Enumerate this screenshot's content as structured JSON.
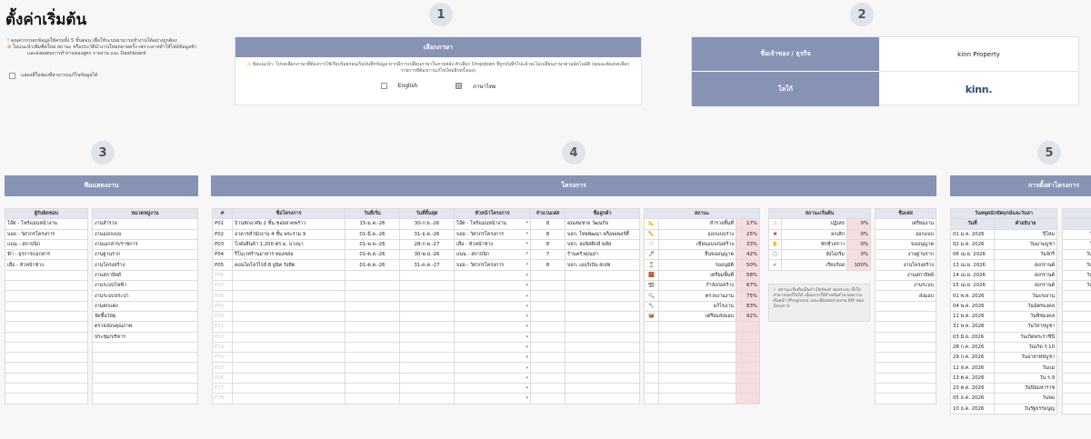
{
  "page_title": "ตั้งค่าเริ่มต้น",
  "notes": {
    "line1": "คุณควรกรอกข้อมูลให้ครบทั้ง 5 ขั้นตอน เพื่อให้ระบบสามารถทำงานได้อย่างถูกต้อง",
    "line2a": "ไม่แนะนำเพิ่มซีตใหม่ สถานะ หรือประวัตินำงานใหม่หลายครั้ง เพราะอาจทำให้ไฟล์ข้อมูลช้า",
    "line2b": "และส่งผลต่อการทำงานของสูตร รายงาน และ Dashboard",
    "checkbox_label": "แสดงสีในช่องที่สามารถแก้ไขข้อมูลได้"
  },
  "steps": [
    "1",
    "2",
    "3",
    "4",
    "5"
  ],
  "language": {
    "header": "เลือกภาษา",
    "hint": "ข้อแนะนำ: โปรดเลือกภาษาที่ต้องการใช้เรียบร้อยก่อนเริ่มบันทึกข้อมูล หากมีการเปลี่ยนภาษาในภายหลัง ตัวเลือก Dropdown ที่ถูกบันทึกไปแล้วจะไม่เปลี่ยนภาษาตามอัตโนมัติ (คุณจะต้องกดเลือกรายการที่ต้องการแก้ไขใหม่อีกครั้งเอง)",
    "english": "English",
    "thai": "ภาษาไทย"
  },
  "owner": {
    "owner_label": "ชื่อเจ้าของ / ธุรกิจ",
    "owner_value": "kinn Property",
    "logo_label": "โลโก้",
    "logo_text": "kinn."
  },
  "team": {
    "header": "ทีมแสดงงาน",
    "owners_header": "ผู้รับผิดชอบ",
    "owners": [
      "โอ๊ต - โฟร์แมนหน้างาน",
      "บอย - วิศวกรโครงการ",
      "แนน - สถาปนิก",
      "ฟ้า - ธุรการ/เอกสาร",
      "เสือ - หัวหน้าช่าง"
    ],
    "category_header": "หมวดหมู่งาน",
    "categories": [
      "งานสำรวจ",
      "งานออกแบบ",
      "งานเอกสาร/ราชการ",
      "งานฐานราก",
      "งานโครงสร้าง",
      "งานสถาปัตย์",
      "งานระบบไฟฟ้า",
      "งานระบบประปา",
      "งานตกแต่ง",
      "จัดซื้อวัสดุ",
      "ตรวจสอบคุณภาพ",
      "ประชุม/บริหาร"
    ]
  },
  "projects": {
    "header": "โครงการ",
    "columns": [
      "#",
      "ชื่อโครงการ",
      "วันที่เริ่ม",
      "วันที่สิ้นสุด",
      "หัวหน้าโครงการ",
      "จำนวนเฟส",
      "ชื่อลูกค้า"
    ],
    "rows": [
      {
        "id": "P01",
        "name": "บ้านพักอาศัย 2 ชั้น ซอยลาดพร้าว",
        "start": "15-ม.ค.-26",
        "end": "30-ก.ย.-26",
        "lead": "โอ๊ต - โฟร์แมนหน้างาน",
        "phases": "8",
        "client": "คุณสมชาย วัฒนกิจ"
      },
      {
        "id": "P02",
        "name": "อาคารสำนักงาน 4 ชั้น พระราม 9",
        "start": "01-มี.ค.-26",
        "end": "31-ธ.ค.-26",
        "lead": "บอย - วิศวกรโครงการ",
        "phases": "8",
        "client": "บจก. ไทยพัฒนา พร็อพเพอร์ตี้"
      },
      {
        "id": "P03",
        "name": "โกดังสินค้า 1,200 ตร.ม. บางนา",
        "start": "01-พ.ค.-26",
        "end": "28-ก.พ.-27",
        "lead": "เสือ - หัวหน้าช่าง",
        "phases": "8",
        "client": "บจก. ลอจิสติกส์ พลัส"
      },
      {
        "id": "P04",
        "name": "รีโนเวทร้านอาหาร ทองหล่อ",
        "start": "01-ต.ค.-26",
        "end": "30-พ.ย.-26",
        "lead": "แนน - สถาปนิก",
        "phases": "7",
        "client": "ร้านครัวคุณย่า"
      },
      {
        "id": "P05",
        "name": "คอนโดโลว์ไรส์ 8 ยูนิต รังสิต",
        "start": "01-ต.ค.-26",
        "end": "31-ค.ค.-27",
        "lead": "บอย - วิศวกรโครงการ",
        "phases": "8",
        "client": "บจก. เออร์เบิน สเปซ"
      }
    ],
    "empty_ids": [
      "P06",
      "P07",
      "P08",
      "P09",
      "P10",
      "P11",
      "P12",
      "P13",
      "P14",
      "P15",
      "P16",
      "P17",
      "P18"
    ]
  },
  "status": {
    "header": "สถานะ",
    "rows": [
      {
        "icon": "ruler-icon",
        "glyph": "📐",
        "label": "สำรวจพื้นที่",
        "pct": "17%"
      },
      {
        "icon": "pencil-icon",
        "glyph": "✏️",
        "label": "ออกแบบร่าง",
        "pct": "25%"
      },
      {
        "icon": "document-icon",
        "glyph": "📄",
        "label": "เขียนแบบก่อสร้าง",
        "pct": "33%"
      },
      {
        "icon": "pen-icon",
        "glyph": "🖊",
        "label": "ยื่นขออนุญาต",
        "pct": "42%"
      },
      {
        "icon": "hourglass-icon",
        "glyph": "⌛",
        "label": "รออนุมัติ",
        "pct": "50%"
      },
      {
        "icon": "bricks-icon",
        "glyph": "🧱",
        "label": "เตรียมพื้นที่",
        "pct": "58%"
      },
      {
        "icon": "crane-icon",
        "glyph": "🏗",
        "label": "กำลังก่อสร้าง",
        "pct": "67%"
      },
      {
        "icon": "magnifier-icon",
        "glyph": "🔍",
        "label": "ตรวจงานงาน",
        "pct": "75%"
      },
      {
        "icon": "wrench-icon",
        "glyph": "🔧",
        "label": "แก้ไขงาน",
        "pct": "83%"
      },
      {
        "icon": "box-icon",
        "glyph": "📦",
        "label": "เตรียมส่งมอบ",
        "pct": "92%"
      }
    ]
  },
  "start_status": {
    "header": "สถานะเริ่มต้น",
    "rows": [
      {
        "icon": "warning-icon",
        "glyph": "⚠",
        "label": "ปฏิเสธ",
        "pct": "0%"
      },
      {
        "icon": "cross-icon",
        "glyph": "✖",
        "label": "ยกเลิก",
        "pct": "0%"
      },
      {
        "icon": "hand-icon",
        "glyph": "✋",
        "label": "พักชั่วคราว",
        "pct": "0%"
      },
      {
        "icon": "clock-icon",
        "glyph": "🕒",
        "label": "ยังไม่เริ่ม",
        "pct": "0%"
      },
      {
        "icon": "check-icon",
        "glyph": "✔",
        "label": "เรียบร้อย",
        "pct": "100%"
      }
    ],
    "note": "สถานะเริ่มต้นเป็นค่า Default ของระบบ ซึ่งไม่สามารถแก้ไขได้ เนื่องจากใช้สำหรับคำนวณความคืบหน้า (Progress) และเชื่อมต่อรายงาน KPI ของโครงการ"
  },
  "phases": {
    "header": "ชื่อเฟส",
    "items": [
      "เตรียมงาน",
      "ออกแบบ",
      "ขออนุญาต",
      "งานฐานราก",
      "งานโครงสร้าง",
      "งานสถาปัตย์",
      "งานระบบ",
      "ส่งมอบ"
    ]
  },
  "settings": {
    "header": "การตั้งค่าโครงการ",
    "holidays_header": "วันหยุดนักขัตฤกษ์และวันลา",
    "col_date": "วันที่",
    "col_desc": "คำอธิบาย",
    "rows": [
      {
        "date": "01 ม.ค. 2026",
        "desc": "ปีใหม่"
      },
      {
        "date": "02 ม.ค. 2026",
        "desc": "วันมาฆบูชา"
      },
      {
        "date": "06 เม.ย. 2026",
        "desc": "วันจักรี"
      },
      {
        "date": "13 เม.ย. 2026",
        "desc": "สงกรานต์"
      },
      {
        "date": "14 เม.ย. 2026",
        "desc": "สงกรานต์"
      },
      {
        "date": "15 เม.ย. 2026",
        "desc": "สงกรานต์"
      },
      {
        "date": "01 พ.ค. 2026",
        "desc": "วันแรงงาน"
      },
      {
        "date": "04 พ.ค. 2026",
        "desc": "วันฉัตรมงคล"
      },
      {
        "date": "11 พ.ค. 2026",
        "desc": "วันพืชมงคล"
      },
      {
        "date": "31 พ.ค. 2026",
        "desc": "วันวิสาขบูชา"
      },
      {
        "date": "03 มิ.ย. 2026",
        "desc": "วันเกิดพระราชินี"
      },
      {
        "date": "28 ก.ค. 2026",
        "desc": "วันเกิด ร.10"
      },
      {
        "date": "29 ก.ค. 2026",
        "desc": "วันอาสาฬหบูชา"
      },
      {
        "date": "12 ส.ค. 2026",
        "desc": "วันแม่"
      },
      {
        "date": "13 ต.ค. 2026",
        "desc": "วัน ร.9"
      },
      {
        "date": "23 ต.ค. 2026",
        "desc": "วันปิยมหาราช"
      },
      {
        "date": "05 ธ.ค. 2026",
        "desc": "วันพ่อ"
      },
      {
        "date": "10 ธ.ค. 2026",
        "desc": "วันรัฐธรรมนูญ"
      }
    ],
    "right_header_partial": "",
    "right_partial": [
      "วัน",
      "วัน",
      "วันพ",
      "วันพ",
      "วันอ",
      "วันอ"
    ]
  }
}
